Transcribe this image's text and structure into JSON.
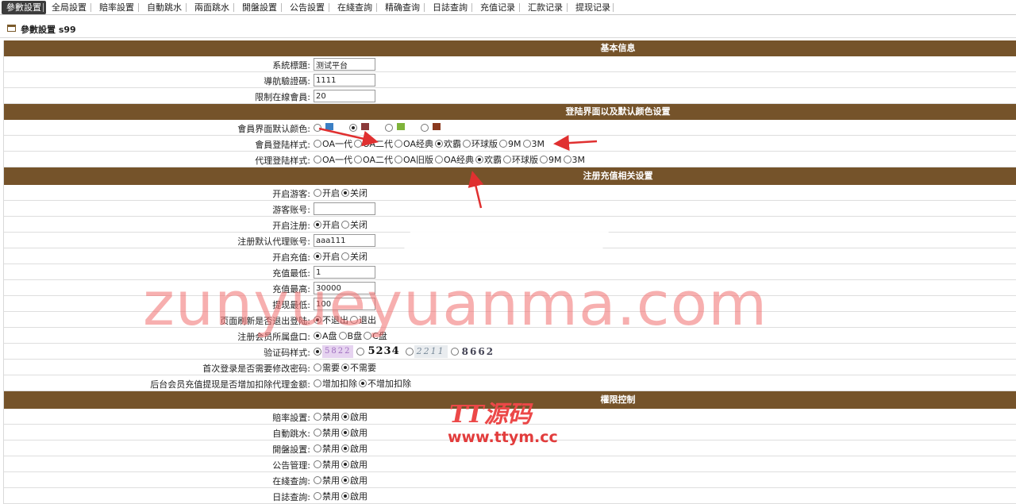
{
  "nav": {
    "tabs": [
      "參數設置",
      "全局設置",
      "賠率設置",
      "自動跳水",
      "兩面跳水",
      "開盤設置",
      "公告設置",
      "在綫查詢",
      "精确查询",
      "日誌查詢",
      "充值记录",
      "汇款记录",
      "提现记录"
    ],
    "active_index": 0
  },
  "page": {
    "title": "參數設置 s99"
  },
  "sections": {
    "basic": "基本信息",
    "login_color": "登陆界面以及默认颜色设置",
    "register": "注册充值相关设置",
    "permission": "權限控制"
  },
  "basic": {
    "system_title_label": "系統標題:",
    "system_title_value": "测试平台",
    "nav_code_label": "導航驗證碼:",
    "nav_code_value": "1111",
    "online_limit_label": "限制在線會員:",
    "online_limit_value": "20"
  },
  "login_color": {
    "default_color_label": "會員界面默认颜色:",
    "colors": [
      "#3b7fc4",
      "#8b3a3a",
      "#7fb33a",
      "#8b3a1f"
    ],
    "member_style_label": "會員登陆样式:",
    "member_styles": [
      "OA一代",
      "OA二代",
      "OA经典",
      "欢霸",
      "环球版",
      "9M",
      "3M"
    ],
    "agent_style_label": "代理登陆样式:",
    "agent_styles": [
      "OA一代",
      "OA二代",
      "OA旧版",
      "OA经典",
      "欢霸",
      "环球版",
      "9M",
      "3M"
    ]
  },
  "register": {
    "guest_label": "开启游客:",
    "guest_on": "开启",
    "guest_off": "关闭",
    "guest_account_label": "游客账号:",
    "guest_account_value": "",
    "reg_label": "开启注册:",
    "reg_on": "开启",
    "reg_off": "关闭",
    "reg_agent_label": "注册默认代理账号:",
    "reg_agent_value": "aaa111",
    "recharge_label": "开启充值:",
    "recharge_on": "开启",
    "recharge_off": "关闭",
    "recharge_min_label": "充值最低:",
    "recharge_min_value": "1",
    "recharge_max_label": "充值最高:",
    "recharge_max_value": "30000",
    "withdraw_min_label": "提现最低:",
    "withdraw_min_value": "100",
    "refresh_logout_label": "页面刷新是否退出登陆:",
    "refresh_no": "不退出",
    "refresh_yes": "退出",
    "panel_label": "注册会员所属盘口:",
    "panels": [
      "A盘",
      "B盘",
      "C盘"
    ],
    "captcha_label": "验证码样式:",
    "captchas": [
      "5822",
      "5234",
      "2211",
      "8662"
    ],
    "first_login_label": "首次登录是否需要修改密码:",
    "first_need": "需要",
    "first_no": "不需要",
    "backend_label": "后台会员充值提现是否增加扣除代理金额:",
    "backend_add": "增加扣除",
    "backend_no": "不增加扣除"
  },
  "permission": {
    "disable": "禁用",
    "enable": "啟用",
    "items": [
      "賠率設置:",
      "自動跳水:",
      "開盤設置:",
      "公告管理:",
      "在綫查詢:",
      "日誌查詢:"
    ]
  },
  "watermark": {
    "main": "zunyueyuanma.com",
    "logo": "TT源码",
    "url": "www.ttym.cc"
  }
}
